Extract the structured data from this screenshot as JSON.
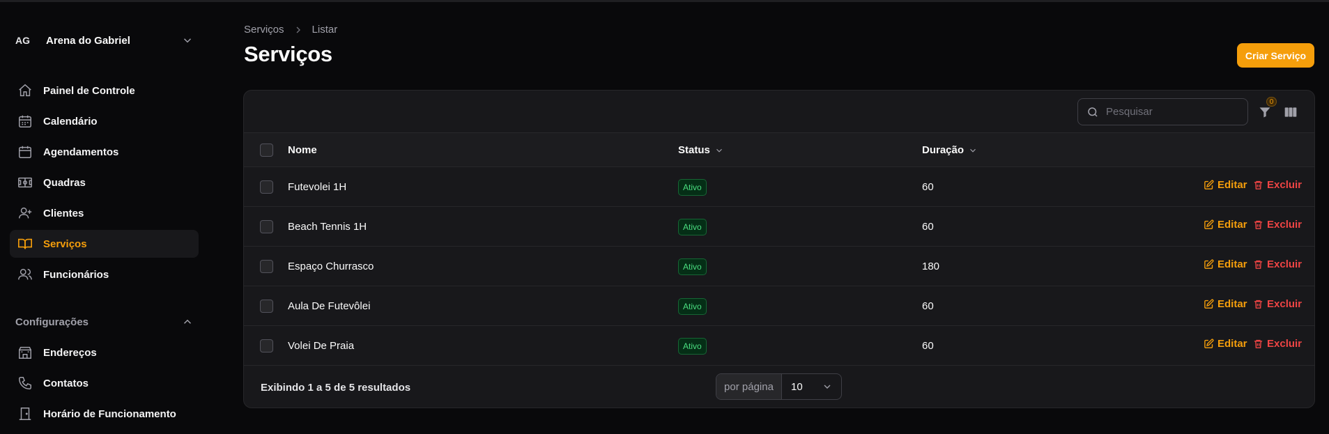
{
  "tenant": {
    "initials": "AG",
    "name": "Arena do Gabriel"
  },
  "nav": [
    {
      "label": "Painel de Controle",
      "icon": "home-icon"
    },
    {
      "label": "Calendário",
      "icon": "calendar-days-icon"
    },
    {
      "label": "Agendamentos",
      "icon": "calendar-icon"
    },
    {
      "label": "Quadras",
      "icon": "court-icon"
    },
    {
      "label": "Clientes",
      "icon": "user-plus-icon"
    },
    {
      "label": "Serviços",
      "icon": "book-open-icon",
      "active": true
    },
    {
      "label": "Funcionários",
      "icon": "users-icon"
    }
  ],
  "settings_group": {
    "title": "Configurações",
    "items": [
      {
        "label": "Endereços",
        "icon": "building-icon"
      },
      {
        "label": "Contatos",
        "icon": "phone-icon"
      },
      {
        "label": "Horário de Funcionamento",
        "icon": "door-icon"
      }
    ]
  },
  "breadcrumb": [
    "Serviços",
    "Listar"
  ],
  "page_title": "Serviços",
  "create_button": "Criar Serviço",
  "search": {
    "placeholder": "Pesquisar",
    "value": ""
  },
  "filter_count": "0",
  "table": {
    "columns": [
      "Nome",
      "Status",
      "Duração"
    ],
    "rows": [
      {
        "name": "Futevolei 1H",
        "status": "Ativo",
        "duration": "60"
      },
      {
        "name": "Beach Tennis 1H",
        "status": "Ativo",
        "duration": "60"
      },
      {
        "name": "Espaço Churrasco",
        "status": "Ativo",
        "duration": "180"
      },
      {
        "name": "Aula De Futevôlei",
        "status": "Ativo",
        "duration": "60"
      },
      {
        "name": "Volei De Praia",
        "status": "Ativo",
        "duration": "60"
      }
    ],
    "edit_label": "Editar",
    "delete_label": "Excluir"
  },
  "pagination": {
    "summary": "Exibindo 1 a 5 de 5 resultados",
    "per_page_label": "por página",
    "per_page_value": "10"
  },
  "colors": {
    "accent": "#f59e0b",
    "danger": "#ef4444",
    "success": "#4ade80",
    "background": "#09090b",
    "card": "#18181b"
  }
}
